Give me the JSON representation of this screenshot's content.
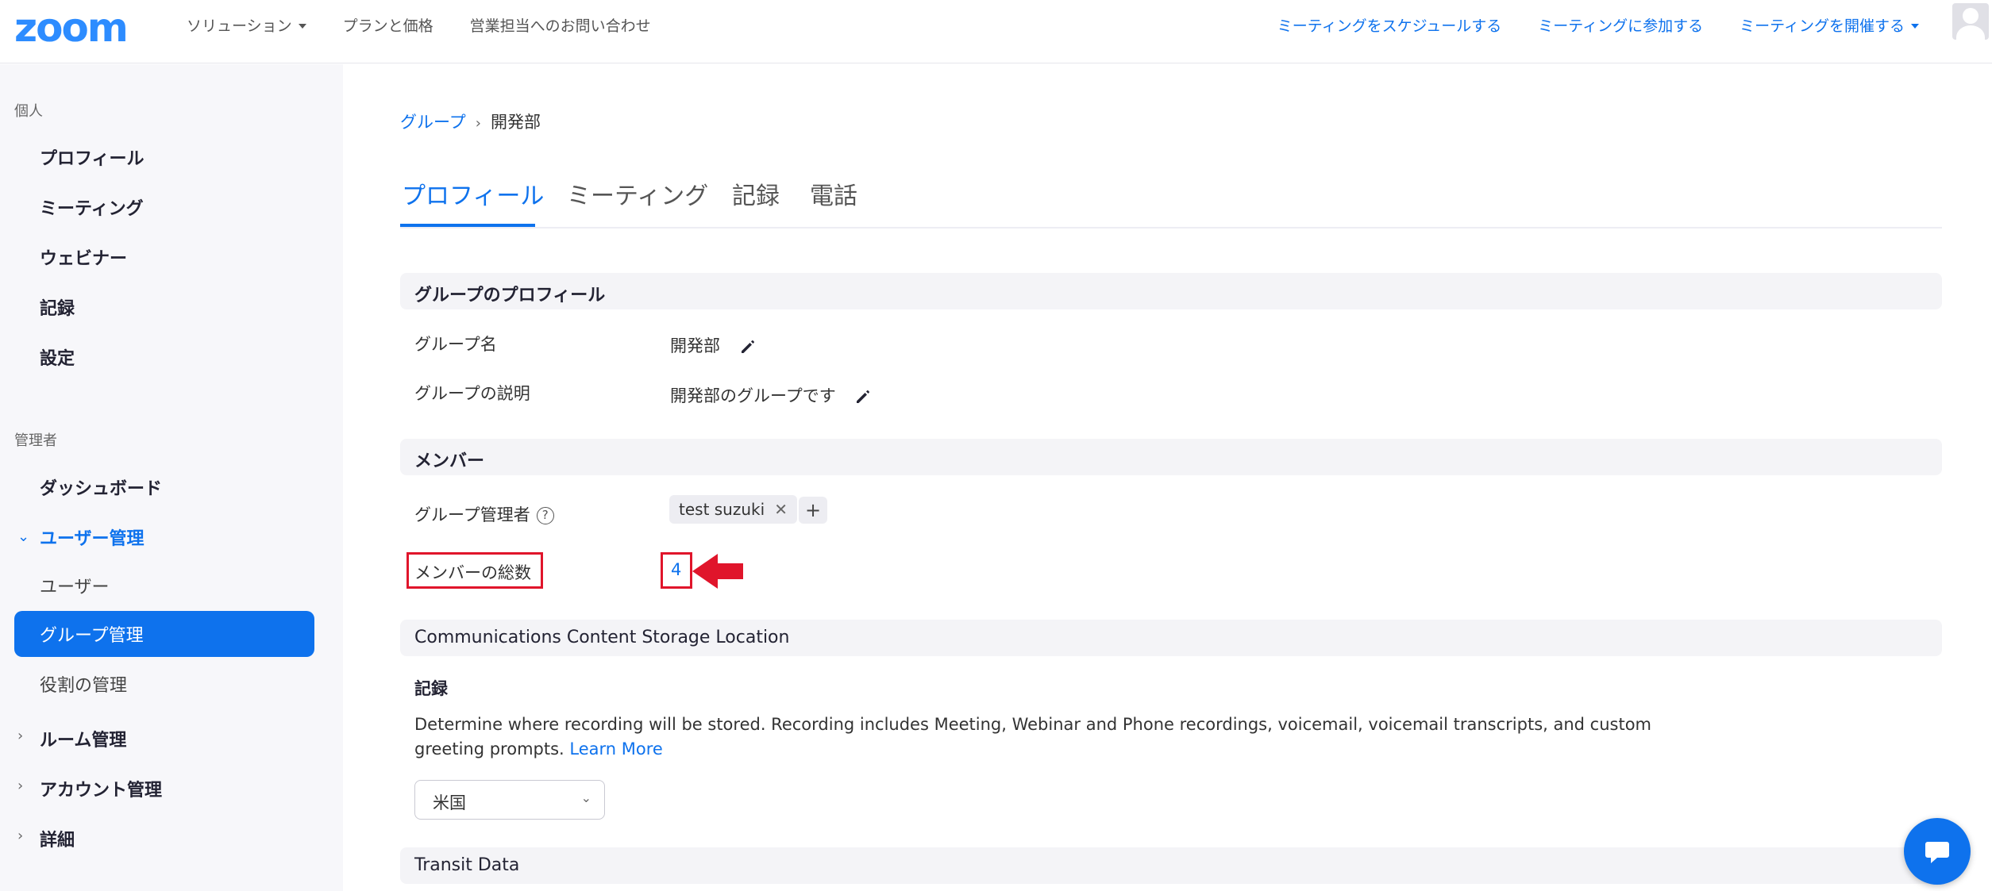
{
  "topbar": {
    "logo": "zoom",
    "left_nav": [
      "ソリューション",
      "プランと価格",
      "営業担当へのお問い合わせ"
    ],
    "right_nav": [
      "ミーティングをスケジュールする",
      "ミーティングに参加する",
      "ミーティングを開催する"
    ]
  },
  "sidebar": {
    "personal_title": "個人",
    "personal_items": [
      "プロフィール",
      "ミーティング",
      "ウェビナー",
      "記録",
      "設定"
    ],
    "admin_title": "管理者",
    "dashboard": "ダッシュボード",
    "user_mgmt": "ユーザー管理",
    "user_mgmt_items": [
      "ユーザー",
      "グループ管理",
      "役割の管理"
    ],
    "active_item": "グループ管理",
    "collapsed_items": [
      "ルーム管理",
      "アカウント管理",
      "詳細"
    ]
  },
  "breadcrumb": {
    "parent": "グループ",
    "current": "開発部"
  },
  "tabs": [
    "プロフィール",
    "ミーティング",
    "記録",
    "電話"
  ],
  "active_tab": "プロフィール",
  "group_profile": {
    "header": "グループのプロフィール",
    "name_label": "グループ名",
    "name_value": "開発部",
    "desc_label": "グループの説明",
    "desc_value": "開発部のグループです"
  },
  "members": {
    "header": "メンバー",
    "admin_label": "グループ管理者",
    "admin_chip": "test suzuki",
    "count_label": "メンバーの総数",
    "count_value": "4"
  },
  "storage": {
    "header": "Communications Content Storage Location",
    "sub_title": "記録",
    "description": "Determine where recording will be stored. Recording includes Meeting, Webinar and Phone recordings, voicemail, voicemail transcripts, and custom greeting prompts.",
    "learn_more": "Learn More",
    "select_value": "米国"
  },
  "transit": {
    "header": "Transit Data"
  },
  "colors": {
    "accent": "#0e72ed",
    "highlight": "#e0152b"
  }
}
